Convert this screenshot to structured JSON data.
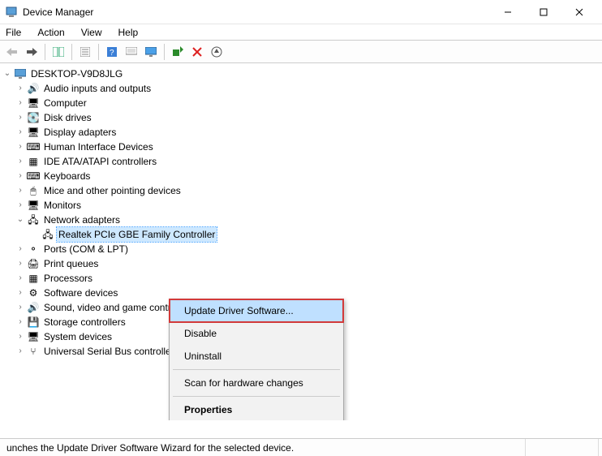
{
  "window": {
    "title": "Device Manager"
  },
  "menu": {
    "file": "File",
    "action": "Action",
    "view": "View",
    "help": "Help"
  },
  "tree": {
    "root": "DESKTOP-V9D8JLG",
    "nodes": [
      {
        "label": "Audio inputs and outputs",
        "icon": "🔊"
      },
      {
        "label": "Computer",
        "icon": "🖥"
      },
      {
        "label": "Disk drives",
        "icon": "💽"
      },
      {
        "label": "Display adapters",
        "icon": "🖥"
      },
      {
        "label": "Human Interface Devices",
        "icon": "⌨"
      },
      {
        "label": "IDE ATA/ATAPI controllers",
        "icon": "▦"
      },
      {
        "label": "Keyboards",
        "icon": "⌨"
      },
      {
        "label": "Mice and other pointing devices",
        "icon": "🖱"
      },
      {
        "label": "Monitors",
        "icon": "🖥"
      }
    ],
    "network": {
      "label": "Network adapters",
      "icon": "🖧",
      "child": {
        "label": "Realtek PCIe GBE Family Controller",
        "icon": "🖧"
      }
    },
    "nodes_after": [
      {
        "label": "Ports (COM & LPT)",
        "icon": "⚬"
      },
      {
        "label": "Print queues",
        "icon": "🖨"
      },
      {
        "label": "Processors",
        "icon": "▦"
      },
      {
        "label": "Software devices",
        "icon": "⚙"
      },
      {
        "label": "Sound, video and game controllers",
        "icon": "🔊"
      },
      {
        "label": "Storage controllers",
        "icon": "💾"
      },
      {
        "label": "System devices",
        "icon": "🖥"
      },
      {
        "label": "Universal Serial Bus controllers",
        "icon": "⑂"
      }
    ]
  },
  "context": {
    "update": "Update Driver Software...",
    "disable": "Disable",
    "uninstall": "Uninstall",
    "scan": "Scan for hardware changes",
    "properties": "Properties"
  },
  "status": {
    "text": "unches the Update Driver Software Wizard for the selected device."
  }
}
